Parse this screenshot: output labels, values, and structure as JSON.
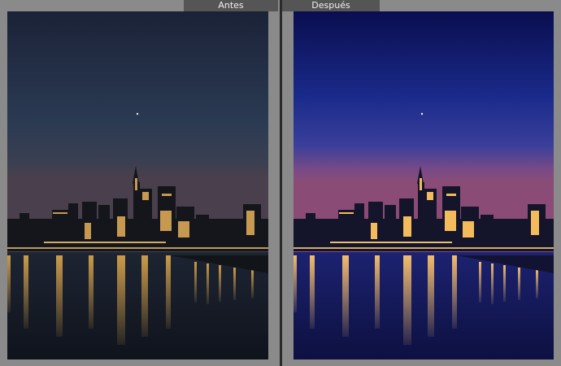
{
  "comparison": {
    "before": {
      "label": "Antes"
    },
    "after": {
      "label": "Después"
    }
  },
  "colors": {
    "background": "#8a8a8a",
    "tab": "#555555",
    "divider": "#2a2a2a",
    "before_sky_top": "#1c2540",
    "before_sky_horizon": "#4a4050",
    "after_sky_top": "#0b0f54",
    "after_sky_horizon": "#8a4a7a",
    "lights": "#ffcf6a"
  }
}
